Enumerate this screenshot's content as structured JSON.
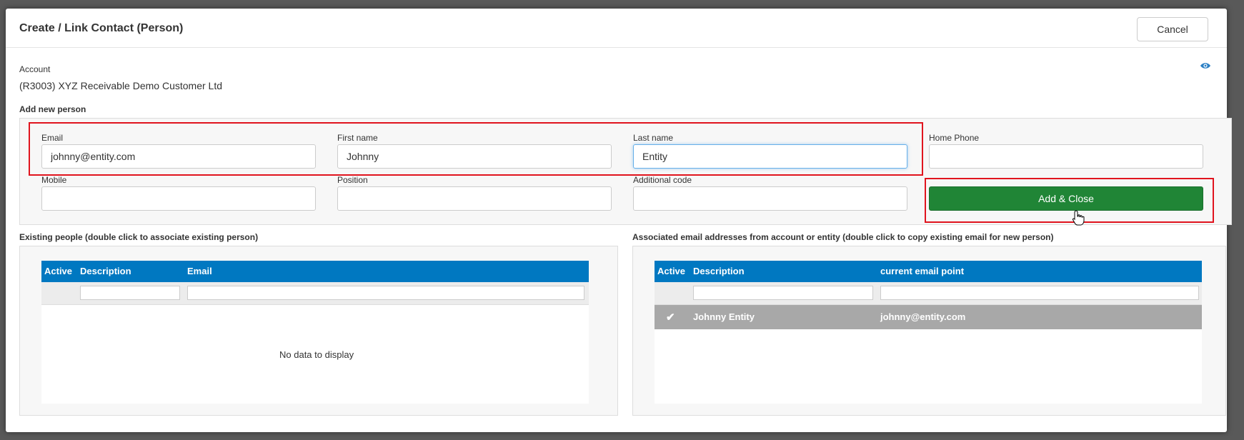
{
  "dialog": {
    "title": "Create / Link Contact (Person)",
    "cancel_label": "Cancel"
  },
  "account": {
    "label": "Account",
    "value": "(R3003) XYZ Receivable Demo Customer Ltd"
  },
  "form": {
    "section_label": "Add new person",
    "email": {
      "label": "Email",
      "value": "johnny@entity.com"
    },
    "first_name": {
      "label": "First name",
      "value": "Johnny"
    },
    "last_name": {
      "label": "Last name",
      "value": "Entity"
    },
    "home_phone": {
      "label": "Home Phone",
      "value": ""
    },
    "mobile": {
      "label": "Mobile",
      "value": ""
    },
    "position": {
      "label": "Position",
      "value": ""
    },
    "additional_code": {
      "label": "Additional code",
      "value": ""
    },
    "add_close_label": "Add & Close"
  },
  "existing_people": {
    "section_label": "Existing people (double click to associate existing person)",
    "columns": [
      "Active",
      "Description",
      "Email"
    ],
    "empty_text": "No data to display"
  },
  "associated_emails": {
    "section_label": "Associated email addresses from account or entity (double click to copy existing email for new person)",
    "columns": [
      "Active",
      "Description",
      "current email point"
    ],
    "rows": [
      {
        "active": "✔",
        "description": "Johnny Entity",
        "email": "johnny@entity.com"
      }
    ]
  },
  "colors": {
    "grid_header": "#0078c1",
    "add_button": "#208536",
    "highlight": "#e0141e",
    "selected_row": "#a8a8a8"
  },
  "icons": [
    "eye-icon",
    "check-icon",
    "hand-cursor-icon"
  ]
}
